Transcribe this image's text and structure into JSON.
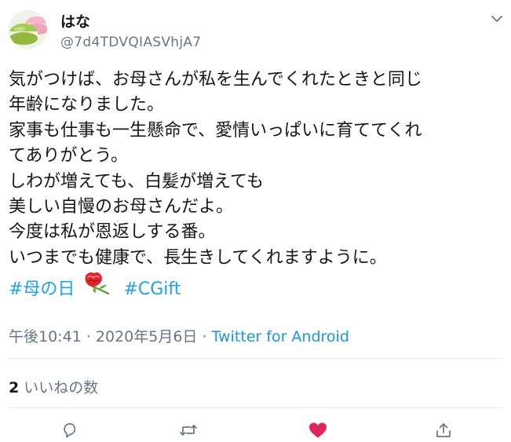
{
  "user": {
    "display_name": "はな",
    "handle": "@7d4TDVQIASVhjA7",
    "avatar_icon": "macaron-avatar-icon"
  },
  "tweet": {
    "lines": [
      "気がつけば、お母さんが私を生んでくれたときと同じ",
      "年齢になりました。",
      "家事も仕事も一生懸命で、愛情いっぱいに育ててくれ",
      "てありがとう。",
      "しわが増えても、白髪が増えても",
      "美しい自慢のお母さんだよ。",
      "今度は私が恩返しする番。",
      "いつまでも健康で、長生きしてくれますように。"
    ],
    "hashtags": [
      "#母の日",
      "#CGift"
    ],
    "hashtag_emoji_icon": "carnation-icon",
    "time": "午後10:41",
    "separator": " · ",
    "date": "2020年5月6日",
    "source": "Twitter for Android"
  },
  "stats": {
    "likes_count": "2",
    "likes_label": "いいねの数"
  },
  "actions": {
    "reply_icon": "reply-icon",
    "retweet_icon": "retweet-icon",
    "like_icon": "heart-icon",
    "share_icon": "share-icon"
  },
  "colors": {
    "link": "#1da1f2",
    "secondary": "#657786",
    "like_active": "#e0245e",
    "divider": "#e6ecf0"
  }
}
